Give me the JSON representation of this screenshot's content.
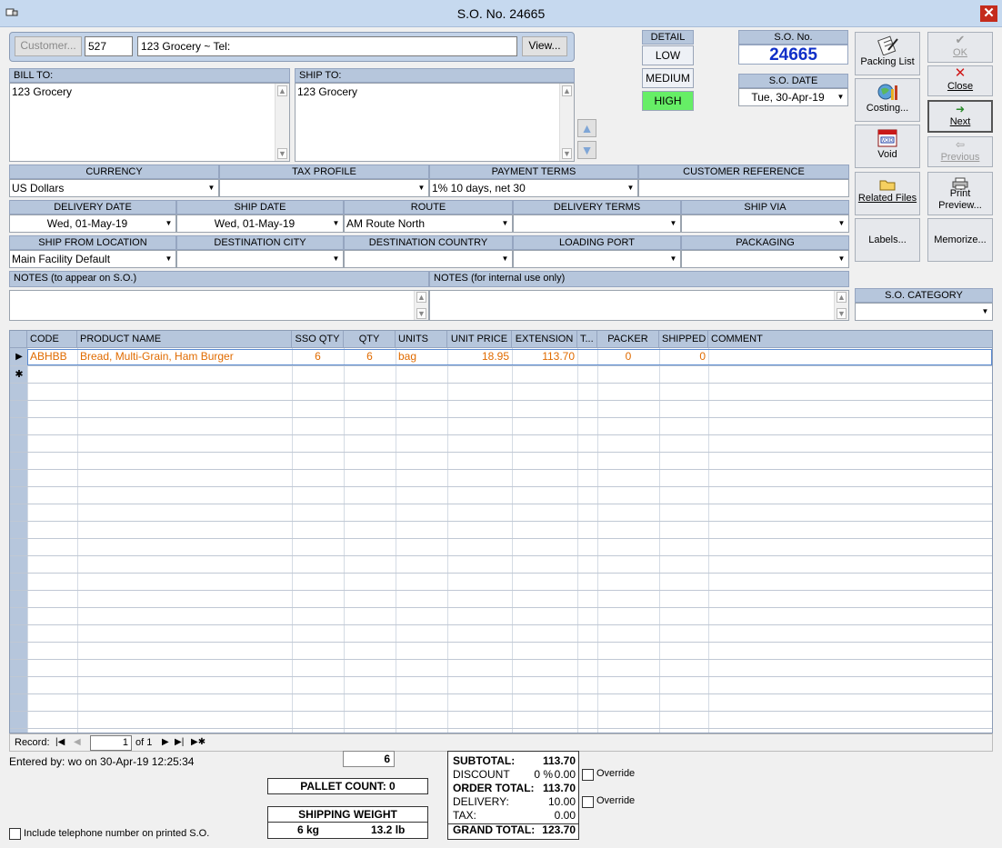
{
  "window": {
    "title": "S.O. No. 24665",
    "close_glyph": "✕"
  },
  "customer": {
    "button_label": "Customer...",
    "id": "527",
    "display": "123 Grocery  ~  Tel:",
    "view_label": "View..."
  },
  "detail": {
    "label": "DETAIL",
    "low": "LOW",
    "medium": "MEDIUM",
    "high": "HIGH",
    "selected": "HIGH",
    "selected_color": "#66ee66"
  },
  "so": {
    "no_label": "S.O. No.",
    "no_value": "24665",
    "date_label": "S.O. DATE",
    "date_value": "Tue, 30-Apr-19",
    "no_color": "#1030c8"
  },
  "bill_to": {
    "label": "BILL TO:",
    "value": "123 Grocery"
  },
  "ship_to": {
    "label": "SHIP TO:",
    "value": "123 Grocery"
  },
  "fields": {
    "currency": {
      "label": "CURRENCY",
      "value": "US Dollars"
    },
    "tax_profile": {
      "label": "TAX PROFILE",
      "value": ""
    },
    "payment_terms": {
      "label": "PAYMENT TERMS",
      "value": "1% 10 days, net 30"
    },
    "customer_reference": {
      "label": "CUSTOMER REFERENCE",
      "value": ""
    },
    "delivery_date": {
      "label": "DELIVERY DATE",
      "value": "Wed, 01-May-19"
    },
    "ship_date": {
      "label": "SHIP DATE",
      "value": "Wed, 01-May-19"
    },
    "route": {
      "label": "ROUTE",
      "value": "AM Route North"
    },
    "delivery_terms": {
      "label": "DELIVERY TERMS",
      "value": ""
    },
    "ship_via": {
      "label": "SHIP VIA",
      "value": ""
    },
    "ship_from": {
      "label": "SHIP FROM LOCATION",
      "value": "Main Facility Default"
    },
    "dest_city": {
      "label": "DESTINATION CITY",
      "value": ""
    },
    "dest_country": {
      "label": "DESTINATION COUNTRY",
      "value": ""
    },
    "loading_port": {
      "label": "LOADING PORT",
      "value": ""
    },
    "packaging": {
      "label": "PACKAGING",
      "value": ""
    },
    "notes_so": {
      "label": "NOTES (to appear on S.O.)",
      "value": ""
    },
    "notes_internal": {
      "label": "NOTES (for internal use only)",
      "value": ""
    },
    "so_category": {
      "label": "S.O. CATEGORY",
      "value": ""
    }
  },
  "toolbar": {
    "packing_list": {
      "label": "Packing List",
      "icon": "clipboard-pen-icon"
    },
    "ok": {
      "label": "OK",
      "icon": "check-icon"
    },
    "close": {
      "label": "Close",
      "icon": "red-x-icon"
    },
    "costing": {
      "label": "Costing...",
      "icon": "globe-chart-icon"
    },
    "next": {
      "label": "Next",
      "icon": "next-arrow-icon"
    },
    "void": {
      "label": "Void",
      "icon": "void-stamp-icon"
    },
    "previous": {
      "label": "Previous",
      "icon": "previous-arrow-icon"
    },
    "related_files": {
      "label": "Related Files",
      "icon": "folder-icon"
    },
    "print_preview": {
      "label1": "Print",
      "label2": "Preview...",
      "icon": "printer-icon"
    },
    "labels": {
      "label": "Labels..."
    },
    "memorize": {
      "label": "Memorize..."
    }
  },
  "grid": {
    "columns": [
      "CODE",
      "PRODUCT NAME",
      "SSO QTY",
      "QTY",
      "UNITS",
      "UNIT PRICE",
      "EXTENSION",
      "T...",
      "PACKER",
      "SHIPPED",
      "COMMENT"
    ],
    "rows": [
      {
        "code": "ABHBB",
        "product": "Bread, Multi-Grain, Ham Burger",
        "sso_qty": "6",
        "qty": "6",
        "units": "bag",
        "unit_price": "18.95",
        "extension": "113.70",
        "t": "",
        "packer": "0",
        "shipped": "0",
        "comment": ""
      }
    ],
    "new_row_glyph": "✱",
    "current_row_glyph": "▶"
  },
  "record_nav": {
    "label": "Record:",
    "current": "1",
    "of": "of 1"
  },
  "footer": {
    "entered_by": "Entered by: wo on 30-Apr-19 12:25:34",
    "qty_total": "6",
    "pallet_count": "PALLET COUNT: 0",
    "shipping_weight_label": "SHIPPING WEIGHT",
    "weight_kg": "6 kg",
    "weight_lb": "13.2 lb",
    "include_tel": "Include telephone number on printed S.O."
  },
  "totals": {
    "subtotal_label": "SUBTOTAL:",
    "subtotal": "113.70",
    "discount_label": "DISCOUNT",
    "discount_pct": "0 %",
    "discount": "0.00",
    "order_total_label": "ORDER TOTAL:",
    "order_total": "113.70",
    "delivery_label": "DELIVERY:",
    "delivery": "10.00",
    "tax_label": "TAX:",
    "tax": "0.00",
    "grand_total_label": "GRAND TOTAL:",
    "grand_total": "123.70",
    "override1": "Override",
    "override2": "Override"
  }
}
